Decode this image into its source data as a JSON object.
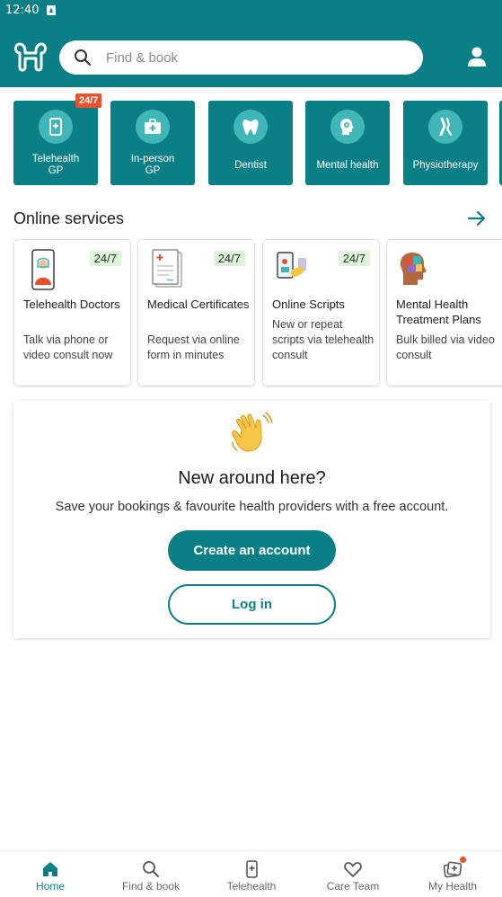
{
  "status_bar": {
    "time": "12:40"
  },
  "header": {
    "search_placeholder": "Find & book"
  },
  "categories": [
    {
      "label_line1": "Telehealth",
      "label_line2": "GP",
      "badge": "24/7"
    },
    {
      "label_line1": "In-person",
      "label_line2": "GP"
    },
    {
      "label_line1": "Dentist"
    },
    {
      "label_line1": "Mental health"
    },
    {
      "label_line1": "Physiotherapy"
    }
  ],
  "online_services": {
    "title": "Online services",
    "items": [
      {
        "title": "Telehealth Doctors",
        "description": "Talk via phone or video consult now",
        "tag": "24/7"
      },
      {
        "title": "Medical Certificates",
        "description": "Request via online form in minutes",
        "tag": "24/7"
      },
      {
        "title": "Online Scripts",
        "description": "New or repeat scripts via telehealth consult",
        "tag": "24/7"
      },
      {
        "title": "Mental Health Treatment Plans",
        "description": "Bulk billed via video consult"
      }
    ]
  },
  "welcome": {
    "heading": "New around here?",
    "text": "Save your bookings & favourite health providers with a free account.",
    "create_button": "Create an account",
    "login_button": "Log in"
  },
  "bottom_nav": [
    {
      "label": "Home",
      "icon": "home-icon",
      "active": true
    },
    {
      "label": "Find & book",
      "icon": "search-icon"
    },
    {
      "label": "Telehealth",
      "icon": "telehealth-phone-icon"
    },
    {
      "label": "Care Team",
      "icon": "heart-icon"
    },
    {
      "label": "My Health",
      "icon": "health-cards-icon",
      "notification": true
    }
  ],
  "colors": {
    "brand": "#0b7f86",
    "accent_badge": "#e9502d",
    "tag_bg": "#dcf5d8"
  }
}
